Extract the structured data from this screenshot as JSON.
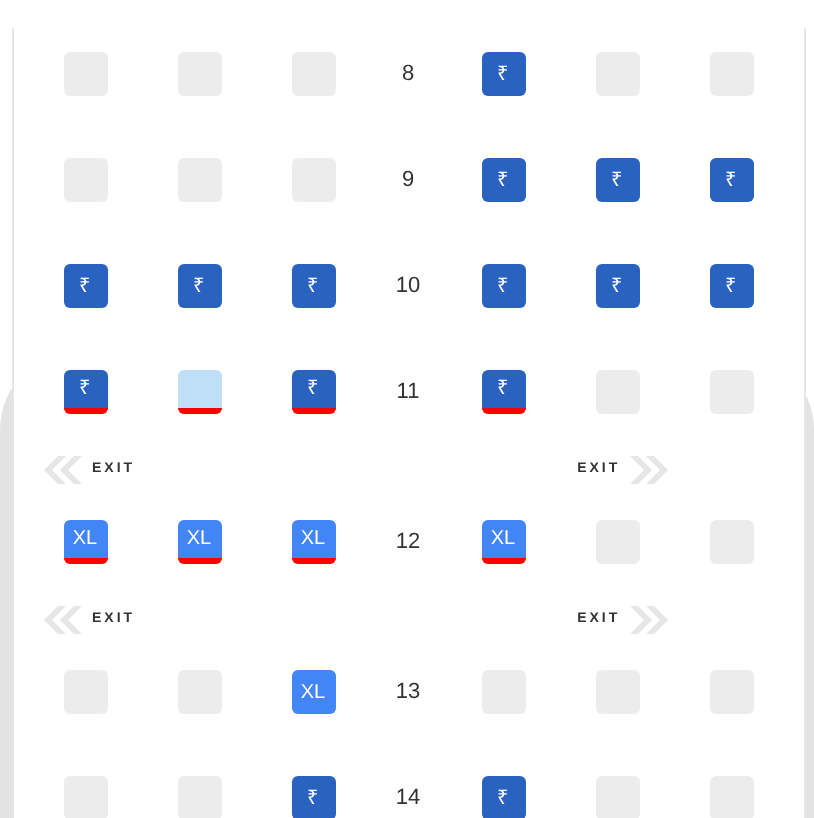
{
  "rows": [
    {
      "kind": "seats",
      "number": "8",
      "seats": [
        {
          "kind": "blocked"
        },
        {
          "kind": "blocked"
        },
        {
          "kind": "blocked"
        },
        {
          "kind": "standard",
          "label": "₹",
          "exit_row": false
        },
        {
          "kind": "blocked"
        },
        {
          "kind": "blocked"
        }
      ]
    },
    {
      "kind": "seats",
      "number": "9",
      "seats": [
        {
          "kind": "blocked"
        },
        {
          "kind": "blocked"
        },
        {
          "kind": "blocked"
        },
        {
          "kind": "standard",
          "label": "₹",
          "exit_row": false
        },
        {
          "kind": "standard",
          "label": "₹",
          "exit_row": false
        },
        {
          "kind": "standard",
          "label": "₹",
          "exit_row": false
        }
      ]
    },
    {
      "kind": "seats",
      "number": "10",
      "seats": [
        {
          "kind": "standard",
          "label": "₹",
          "exit_row": false
        },
        {
          "kind": "standard",
          "label": "₹",
          "exit_row": false
        },
        {
          "kind": "standard",
          "label": "₹",
          "exit_row": false
        },
        {
          "kind": "standard",
          "label": "₹",
          "exit_row": false
        },
        {
          "kind": "standard",
          "label": "₹",
          "exit_row": false
        },
        {
          "kind": "standard",
          "label": "₹",
          "exit_row": false
        }
      ]
    },
    {
      "kind": "seats",
      "number": "11",
      "seats": [
        {
          "kind": "standard",
          "label": "₹",
          "exit_row": true
        },
        {
          "kind": "light",
          "exit_row": true
        },
        {
          "kind": "standard",
          "label": "₹",
          "exit_row": true
        },
        {
          "kind": "standard",
          "label": "₹",
          "exit_row": true
        },
        {
          "kind": "blocked"
        },
        {
          "kind": "blocked"
        }
      ]
    },
    {
      "kind": "exit",
      "left": "EXIT",
      "right": "EXIT"
    },
    {
      "kind": "seats",
      "number": "12",
      "seats": [
        {
          "kind": "xl",
          "label": "XL",
          "exit_row": true
        },
        {
          "kind": "xl",
          "label": "XL",
          "exit_row": true
        },
        {
          "kind": "xl",
          "label": "XL",
          "exit_row": true
        },
        {
          "kind": "xl",
          "label": "XL",
          "exit_row": true
        },
        {
          "kind": "blocked"
        },
        {
          "kind": "blocked"
        }
      ]
    },
    {
      "kind": "exit",
      "left": "EXIT",
      "right": "EXIT"
    },
    {
      "kind": "seats",
      "number": "13",
      "seats": [
        {
          "kind": "blocked"
        },
        {
          "kind": "blocked"
        },
        {
          "kind": "xl",
          "label": "XL",
          "exit_row": false
        },
        {
          "kind": "blocked"
        },
        {
          "kind": "blocked"
        },
        {
          "kind": "blocked"
        }
      ]
    },
    {
      "kind": "seats",
      "number": "14",
      "seats": [
        {
          "kind": "blocked"
        },
        {
          "kind": "blocked"
        },
        {
          "kind": "standard",
          "label": "₹",
          "exit_row": false
        },
        {
          "kind": "standard",
          "label": "₹",
          "exit_row": false
        },
        {
          "kind": "blocked"
        },
        {
          "kind": "blocked"
        }
      ]
    }
  ]
}
